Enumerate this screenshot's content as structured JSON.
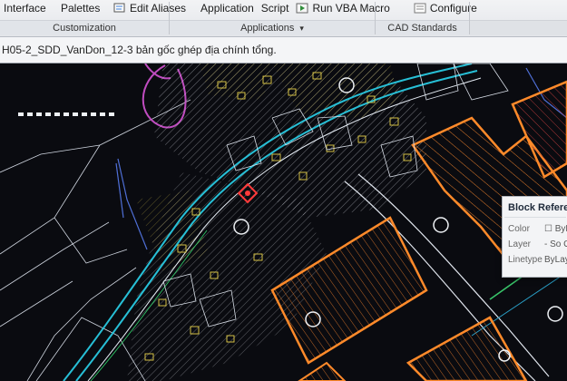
{
  "ribbon": {
    "items": [
      {
        "label": "Interface",
        "icon": "none"
      },
      {
        "label": "Palettes",
        "icon": "none"
      },
      {
        "label": "Edit Aliases",
        "icon": "edit-aliases-icon"
      },
      {
        "label": "Application",
        "icon": "none"
      },
      {
        "label": "Script",
        "icon": "none"
      },
      {
        "label": "Run VBA Macro",
        "icon": "run-vba-icon"
      },
      {
        "label": "Configure",
        "icon": "configure-icon"
      }
    ],
    "panels": [
      {
        "label": "Customization"
      },
      {
        "label": "Applications",
        "dropdown": "▾"
      },
      {
        "label": "CAD Standards"
      }
    ]
  },
  "document_tab": {
    "title": "H05-2_SDD_VanDon_12-3 bản gốc ghép địa chính tổng."
  },
  "tooltip": {
    "title": "Block Reference",
    "rows": [
      {
        "label": "Color",
        "value": "☐ ByL"
      },
      {
        "label": "Layer",
        "value": "- So G"
      },
      {
        "label": "Linetype",
        "value": "ByLay"
      }
    ]
  },
  "colors": {
    "canvas_bg": "#0a0b10",
    "parcel_white": "#d8dde6",
    "parcel_yellow": "#e7d24a",
    "road_cyan": "#29c4d8",
    "hatch_orange": "#ff8a2a",
    "magenta": "#c050c0",
    "green": "#39c56a",
    "red": "#ff3a3a"
  }
}
